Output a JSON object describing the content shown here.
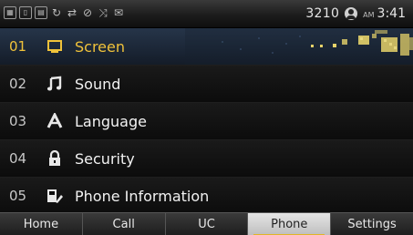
{
  "status": {
    "extension": "3210",
    "ampm": "AM",
    "time": "3:41",
    "icons": [
      "network-icon",
      "phone-lock-icon",
      "keypad-lock-icon",
      "call-forward-icon",
      "call-transfer-icon",
      "dnd-icon",
      "missed-call-icon",
      "message-icon"
    ]
  },
  "menu": {
    "items": [
      {
        "number": "01",
        "label": "Screen",
        "icon": "screen-icon"
      },
      {
        "number": "02",
        "label": "Sound",
        "icon": "music-note-icon"
      },
      {
        "number": "03",
        "label": "Language",
        "icon": "language-icon"
      },
      {
        "number": "04",
        "label": "Security",
        "icon": "lock-icon"
      },
      {
        "number": "05",
        "label": "Phone Information",
        "icon": "phone-info-icon"
      }
    ],
    "selected_index": 0
  },
  "tabs": [
    {
      "label": "Home"
    },
    {
      "label": "Call"
    },
    {
      "label": "UC"
    },
    {
      "label": "Phone"
    },
    {
      "label": "Settings"
    }
  ],
  "active_tab": "Phone",
  "colors": {
    "highlight_text": "#f0c23a",
    "selected_row": "#1f2b3c",
    "active_tab_underline": "#e1b526"
  }
}
